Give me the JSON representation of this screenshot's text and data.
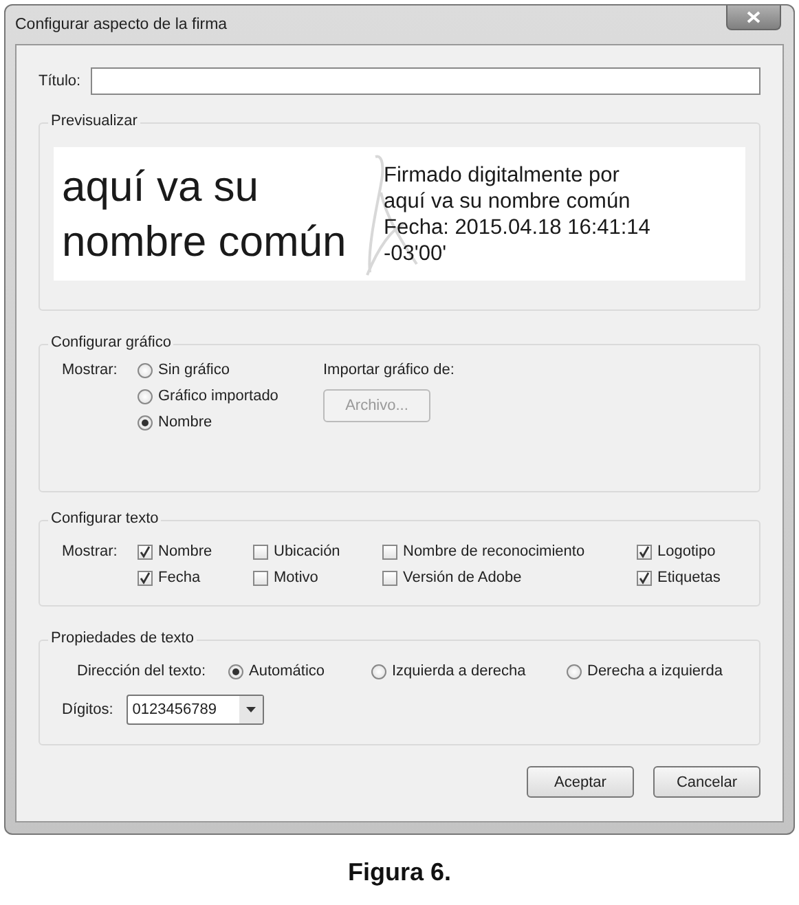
{
  "window": {
    "title": "Configurar aspecto de la firma"
  },
  "title_field": {
    "label": "Título:"
  },
  "preview": {
    "legend": "Previsualizar",
    "name_text": "aquí va su nombre común",
    "detail_lines": [
      "Firmado digitalmente por",
      "aquí va su nombre común",
      "Fecha: 2015.04.18 16:41:14",
      "-03'00'"
    ]
  },
  "graphic": {
    "legend": "Configurar gráfico",
    "show_label": "Mostrar:",
    "options": [
      {
        "label": "Sin gráfico",
        "selected": false
      },
      {
        "label": "Gráfico importado",
        "selected": false
      },
      {
        "label": "Nombre",
        "selected": true
      }
    ],
    "import_label": "Importar gráfico de:",
    "file_button": {
      "label": "Archivo...",
      "disabled": true
    }
  },
  "text_config": {
    "legend": "Configurar texto",
    "show_label": "Mostrar:",
    "checkboxes": [
      {
        "label": "Nombre",
        "checked": true
      },
      {
        "label": "Ubicación",
        "checked": false
      },
      {
        "label": "Nombre de reconocimiento",
        "checked": false
      },
      {
        "label": "Logotipo",
        "checked": true
      },
      {
        "label": "Fecha",
        "checked": true
      },
      {
        "label": "Motivo",
        "checked": false
      },
      {
        "label": "Versión de Adobe",
        "checked": false
      },
      {
        "label": "Etiquetas",
        "checked": true
      }
    ]
  },
  "text_properties": {
    "legend": "Propiedades de texto",
    "direction_label": "Dirección del texto:",
    "directions": [
      {
        "label": "Automático",
        "selected": true
      },
      {
        "label": "Izquierda a derecha",
        "selected": false
      },
      {
        "label": "Derecha a izquierda",
        "selected": false
      }
    ],
    "digits_label": "Dígitos:",
    "digits_value": "0123456789"
  },
  "buttons": [
    {
      "label": "Aceptar"
    },
    {
      "label": "Cancelar"
    }
  ],
  "caption": "Figura 6."
}
